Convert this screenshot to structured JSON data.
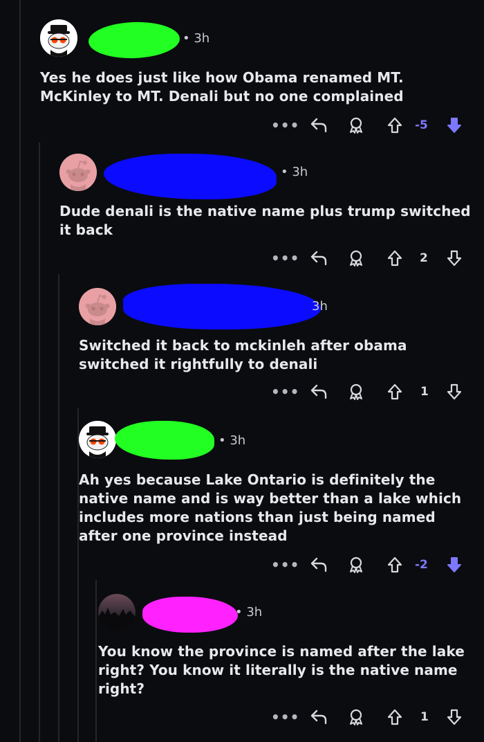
{
  "comments": [
    {
      "time": "• 3h",
      "body": "Yes he does just like how Obama renamed MT. McKinley to MT. Denali but no one complained",
      "score": "-5",
      "vote_state": "downvoted",
      "avatar_icon": "snoo-top-hat-avatar",
      "blob_color": "#22ff22"
    },
    {
      "time": "• 3h",
      "body": "Dude denali is the native name plus trump switched it back",
      "score": "2",
      "vote_state": "none",
      "avatar_icon": "snoo-pink-avatar",
      "blob_color": "#0b0bff"
    },
    {
      "time": "3h",
      "body": "Switched it back to mckinleh after obama switched it rightfully to denali",
      "score": "1",
      "vote_state": "none",
      "avatar_icon": "snoo-pink-avatar",
      "blob_color": "#0b0bff"
    },
    {
      "time": "• 3h",
      "body": "Ah yes because Lake Ontario is definitely the native name and is way better than a lake which includes more nations than just being named after one province instead",
      "score": "-2",
      "vote_state": "downvoted",
      "avatar_icon": "snoo-top-hat-avatar",
      "blob_color": "#22ff22"
    },
    {
      "time": "• 3h",
      "body": "You know the province is named after the lake right? You know it literally is the native name right?",
      "score": "1",
      "vote_state": "none",
      "avatar_icon": "photo-avatar",
      "blob_color": "#ff22ff"
    }
  ],
  "actions": {
    "more": "•••"
  },
  "colors": {
    "background": "#0b0c10",
    "downvote_active": "#7d78ff",
    "text": "#e8e9ec"
  }
}
